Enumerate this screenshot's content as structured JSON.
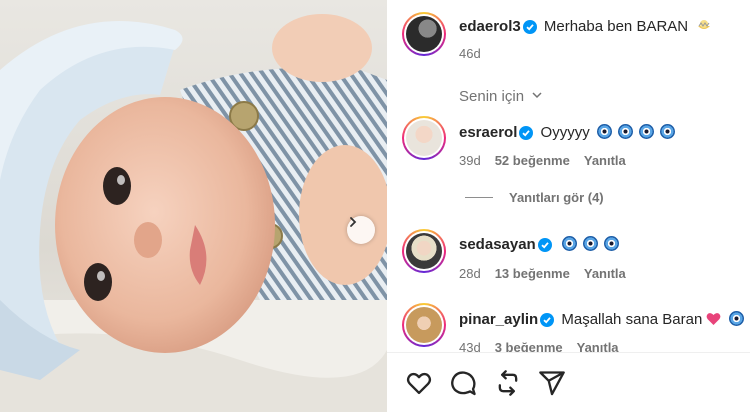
{
  "post": {
    "author": "edaerol3",
    "caption": "Merhaba ben BARAN",
    "caption_emoji": "baby-chick-icon",
    "time": "46d"
  },
  "sort": {
    "label": "Senin için"
  },
  "comments": [
    {
      "username": "esraerol",
      "text": "Oyyyyy",
      "emoji_count": 4,
      "time": "39d",
      "likes": "52 beğenme",
      "reply": "Yanıtla"
    },
    {
      "username": "sedasayan",
      "text": "",
      "emoji_count": 3,
      "time": "28d",
      "likes": "13 beğenme",
      "reply": "Yanıtla"
    },
    {
      "username": "pinar_aylin",
      "text": "Maşallah sana Baran",
      "emoji_count": 1,
      "time": "43d",
      "likes": "3 beğenme",
      "reply": "Yanıtla"
    }
  ],
  "view_replies": "Yanıtları gör (4)",
  "actions": [
    "like-icon",
    "comment-icon",
    "repost-icon",
    "share-icon"
  ],
  "colors": {
    "verified": "#0095f6",
    "heart": "#e8437a",
    "text": "#262626",
    "muted": "#737373"
  }
}
